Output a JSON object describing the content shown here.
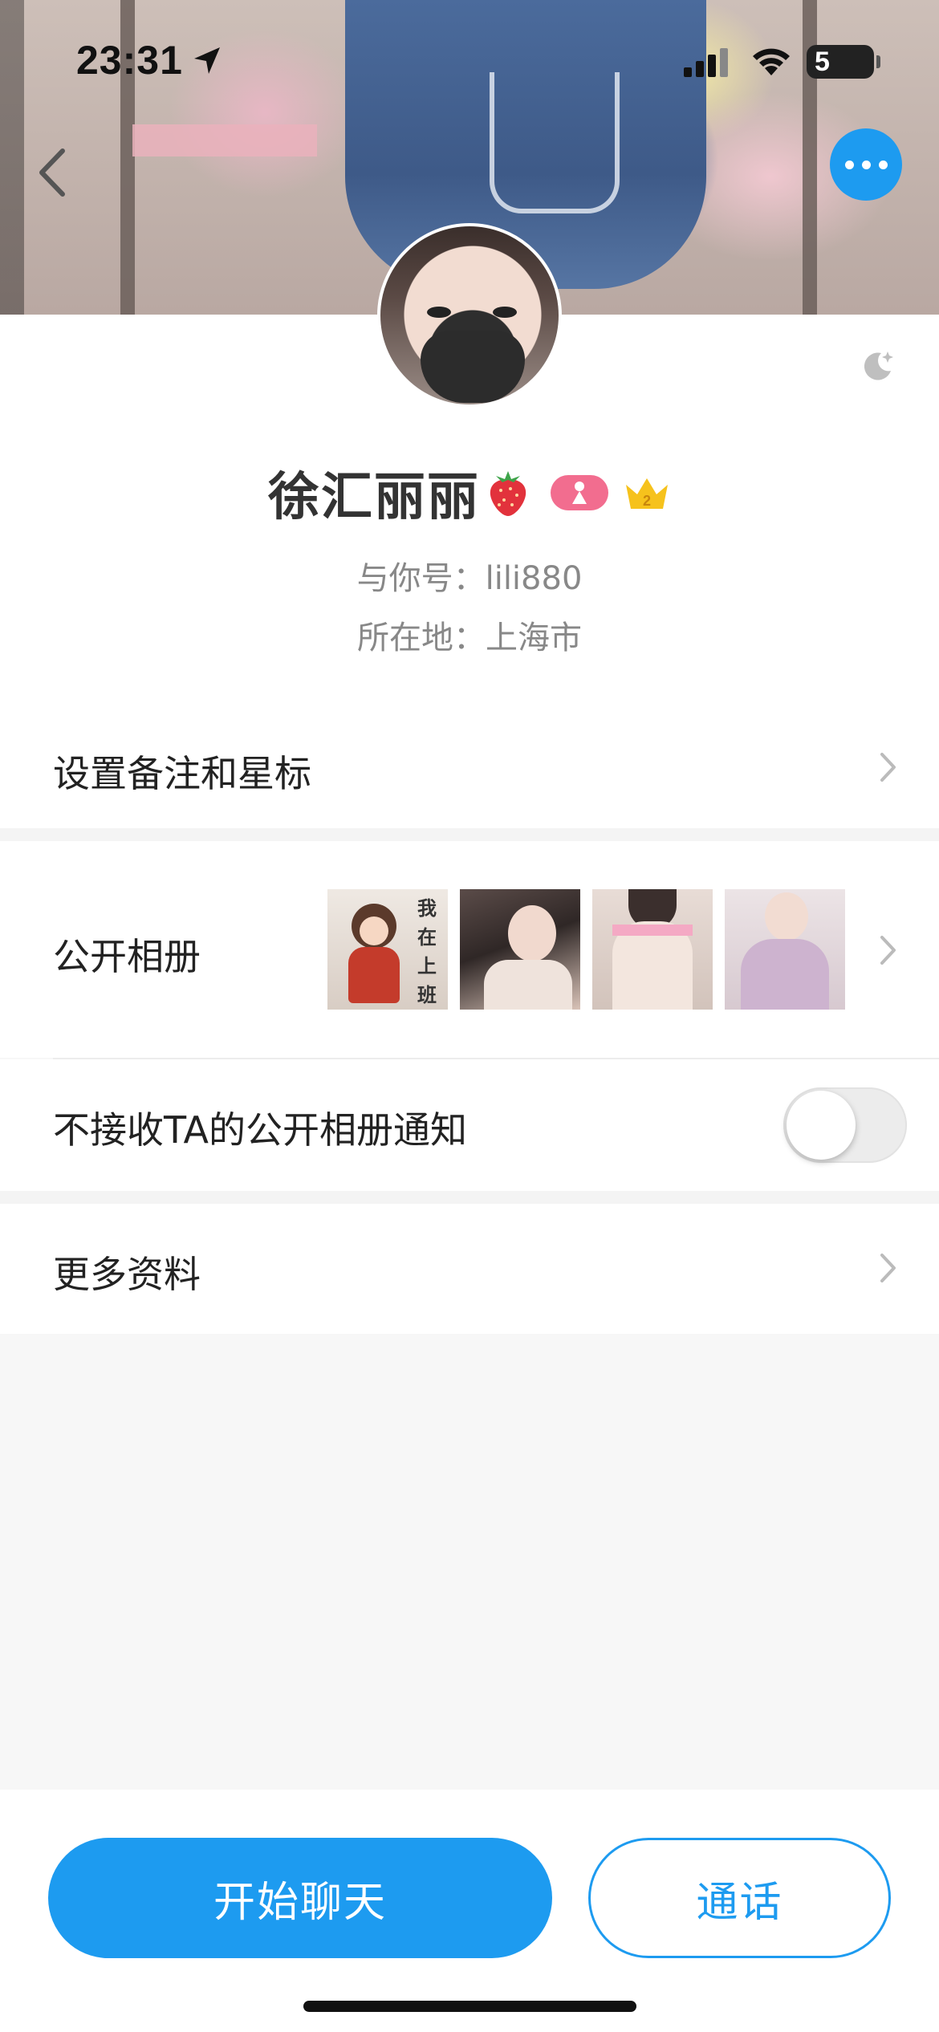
{
  "status_bar": {
    "time": "23:31",
    "battery": "5"
  },
  "profile": {
    "name": "徐汇丽丽",
    "wechat_id_line": "与你号：lili880",
    "location_line": "所在地：上海市"
  },
  "menu": {
    "remark_label": "设置备注和星标",
    "album_label": "公开相册",
    "album_mute_label": "不接收TA的公开相册通知",
    "album_mute_on": false,
    "more_info_label": "更多资料"
  },
  "album_thumbs": [
    {
      "name": "cartoon-girl",
      "text": "我在上班"
    },
    {
      "name": "photo-2"
    },
    {
      "name": "photo-3"
    },
    {
      "name": "photo-4"
    }
  ],
  "actions": {
    "chat_label": "开始聊天",
    "call_label": "通话"
  },
  "icons": [
    "location-arrow-icon",
    "signal-icon",
    "wifi-icon",
    "battery-icon",
    "back-icon",
    "more-icon",
    "dark-mode-icon",
    "strawberry-icon",
    "gender-badge-icon",
    "crown-icon",
    "chevron-right-icon"
  ],
  "colors": {
    "accent": "#1d9bf0",
    "badge_pink": "#f26d8f",
    "crown": "#f6c21c"
  }
}
